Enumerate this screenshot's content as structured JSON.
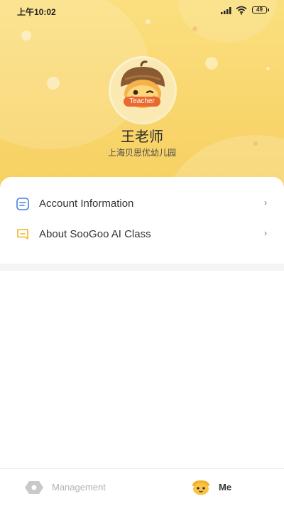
{
  "status_bar": {
    "time": "上午10:02",
    "battery": "49"
  },
  "profile": {
    "badge": "Teacher",
    "name": "王老师",
    "school": "上海贝思优幼儿园"
  },
  "menu": [
    {
      "label": "Account Information",
      "icon": "document-icon",
      "chevron": "›"
    },
    {
      "label": "About SooGoo AI Class",
      "icon": "info-card-icon",
      "chevron": "›"
    }
  ],
  "tabbar": {
    "tabs": [
      {
        "label": "Management",
        "icon": "hexagon-icon",
        "active": false
      },
      {
        "label": "Me",
        "icon": "mascot-icon",
        "active": true
      }
    ]
  },
  "colors": {
    "header": "#f8d56b",
    "accent_blue": "#4a7fe0",
    "accent_orange": "#f2b228"
  }
}
